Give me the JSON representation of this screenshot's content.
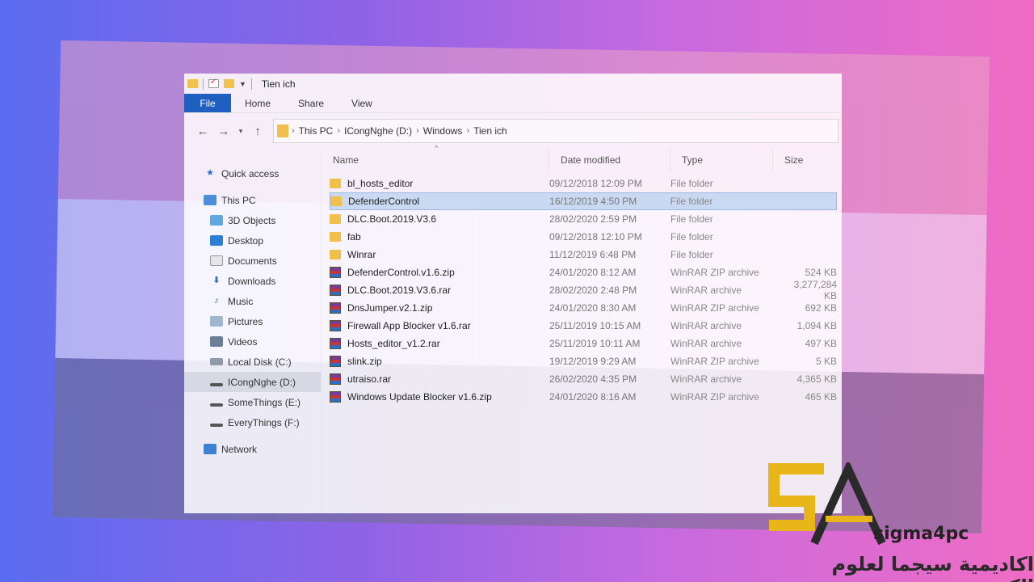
{
  "window": {
    "title": "Tien ich"
  },
  "ribbon": {
    "tabs": [
      "File",
      "Home",
      "Share",
      "View"
    ]
  },
  "address": {
    "crumbs": [
      "This PC",
      "ICongNghe (D:)",
      "Windows",
      "Tien ich"
    ]
  },
  "sidebar": {
    "items": [
      {
        "label": "Quick access",
        "icon": "star-icon"
      },
      {
        "label": "This PC",
        "icon": "pc-icon"
      },
      {
        "label": "3D Objects",
        "icon": "cube-icon"
      },
      {
        "label": "Desktop",
        "icon": "desktop-icon"
      },
      {
        "label": "Documents",
        "icon": "document-icon"
      },
      {
        "label": "Downloads",
        "icon": "download-icon"
      },
      {
        "label": "Music",
        "icon": "music-icon"
      },
      {
        "label": "Pictures",
        "icon": "picture-icon"
      },
      {
        "label": "Videos",
        "icon": "video-icon"
      },
      {
        "label": "Local Disk (C:)",
        "icon": "drive-icon"
      },
      {
        "label": "ICongNghe (D:)",
        "icon": "drive-icon"
      },
      {
        "label": "SomeThings (E:)",
        "icon": "drive-icon"
      },
      {
        "label": "EveryThings (F:)",
        "icon": "drive-icon"
      },
      {
        "label": "Network",
        "icon": "network-icon"
      }
    ]
  },
  "columns": {
    "name": "Name",
    "date": "Date modified",
    "type": "Type",
    "size": "Size"
  },
  "files": [
    {
      "name": "bl_hosts_editor",
      "date": "09/12/2018 12:09 PM",
      "type": "File folder",
      "size": ""
    },
    {
      "name": "DefenderControl",
      "date": "16/12/2019 4:50 PM",
      "type": "File folder",
      "size": ""
    },
    {
      "name": "DLC.Boot.2019.V3.6",
      "date": "28/02/2020 2:59 PM",
      "type": "File folder",
      "size": ""
    },
    {
      "name": "fab",
      "date": "09/12/2018 12:10 PM",
      "type": "File folder",
      "size": ""
    },
    {
      "name": "Winrar",
      "date": "11/12/2019 6:48 PM",
      "type": "File folder",
      "size": ""
    },
    {
      "name": "DefenderControl.v1.6.zip",
      "date": "24/01/2020 8:12 AM",
      "type": "WinRAR ZIP archive",
      "size": "524 KB"
    },
    {
      "name": "DLC.Boot.2019.V3.6.rar",
      "date": "28/02/2020 2:48 PM",
      "type": "WinRAR archive",
      "size": "3,277,284 KB"
    },
    {
      "name": "DnsJumper.v2.1.zip",
      "date": "24/01/2020 8:30 AM",
      "type": "WinRAR ZIP archive",
      "size": "692 KB"
    },
    {
      "name": "Firewall App Blocker v1.6.rar",
      "date": "25/11/2019 10:15 AM",
      "type": "WinRAR archive",
      "size": "1,094 KB"
    },
    {
      "name": "Hosts_editor_v1.2.rar",
      "date": "25/11/2019 10:11 AM",
      "type": "WinRAR archive",
      "size": "497 KB"
    },
    {
      "name": "slink.zip",
      "date": "19/12/2019 9:29 AM",
      "type": "WinRAR ZIP archive",
      "size": "5 KB"
    },
    {
      "name": "utraiso.rar",
      "date": "26/02/2020 4:35 PM",
      "type": "WinRAR archive",
      "size": "4,365 KB"
    },
    {
      "name": "Windows Update Blocker v1.6.zip",
      "date": "24/01/2020 8:16 AM",
      "type": "WinRAR ZIP archive",
      "size": "465 KB"
    }
  ],
  "watermark": {
    "brand": "sigma4pc",
    "arabic": "اكاديمية سيجما لعلوم الكمبيوتر"
  },
  "colors": {
    "file_tab": "#1f5fbf",
    "folder": "#f1c04c",
    "selection": "#c3d6f0"
  }
}
